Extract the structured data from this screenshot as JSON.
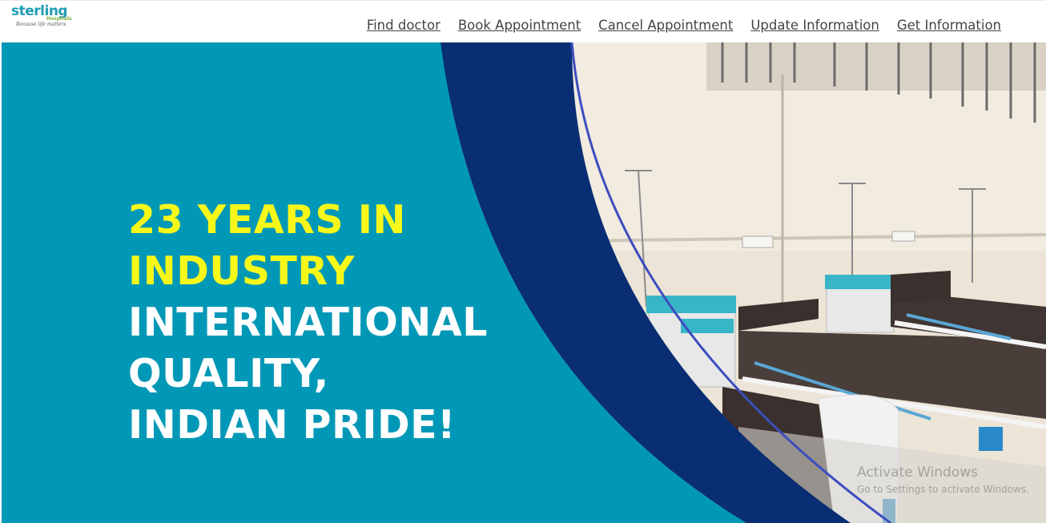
{
  "logo": {
    "brand": "sterling",
    "sub": "Hospitals",
    "tagline": "Because life matters"
  },
  "nav": {
    "items": [
      {
        "label": "Find doctor"
      },
      {
        "label": "Book Appointment"
      },
      {
        "label": "Cancel Appointment"
      },
      {
        "label": "Update Information"
      },
      {
        "label": "Get Information"
      }
    ]
  },
  "hero": {
    "line1": "23 YEARS IN",
    "line2": "INDUSTRY",
    "line3": "INTERNATIONAL",
    "line4": "QUALITY,",
    "line5": "INDIAN PRIDE!"
  },
  "watermark": {
    "title": "Activate Windows",
    "subtitle": "Go to Settings to activate Windows."
  },
  "colors": {
    "teal": "#0098b6",
    "navy": "#0a2e73",
    "highlight": "#f7f71a",
    "link": "#444444"
  }
}
